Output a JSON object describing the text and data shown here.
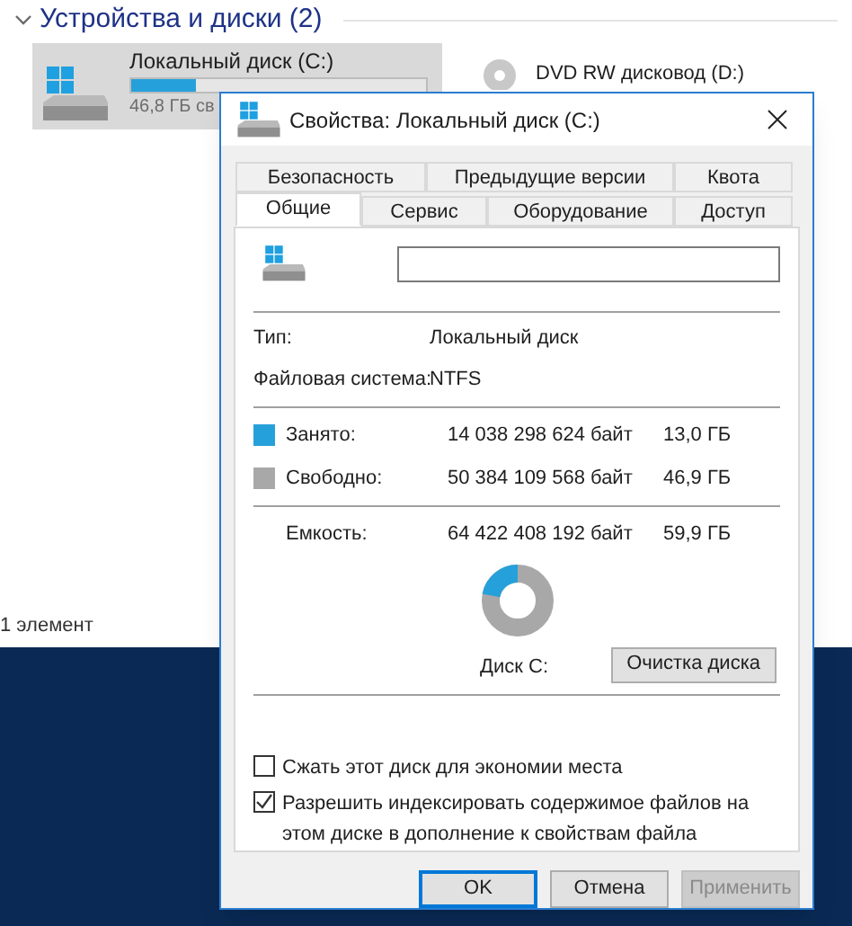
{
  "explorer": {
    "group_header": "Устройства и диски (2)",
    "drives": [
      {
        "kind": "hdd",
        "name": "Локальный диск (C:)",
        "selected": true,
        "level": 0.22,
        "free_text": "46,8 ГБ св"
      },
      {
        "kind": "dvd",
        "name": "DVD RW дисковод (D:)",
        "selected": false
      }
    ],
    "status_bar": "1 элемент"
  },
  "dialog": {
    "title": "Свойства: Локальный диск (C:)",
    "tab_rows": [
      [
        {
          "label": "Безопасность",
          "selected": false
        },
        {
          "label": "Предыдущие версии",
          "selected": false
        },
        {
          "label": "Квота",
          "selected": false
        }
      ],
      [
        {
          "label": "Общие",
          "selected": true
        },
        {
          "label": "Сервис",
          "selected": false
        },
        {
          "label": "Оборудование",
          "selected": false
        },
        {
          "label": "Доступ",
          "selected": false
        }
      ]
    ],
    "info": [
      {
        "label": "Тип:",
        "value": "Локальный диск"
      },
      {
        "label": "Файловая система:",
        "value": "NTFS"
      }
    ],
    "usage": [
      {
        "label": "Занято:",
        "bytes": "14 038 298 624 байт",
        "size": "13,0 ГБ",
        "color": "#26a0da"
      },
      {
        "label": "Свободно:",
        "bytes": "50 384 109 568 байт",
        "size": "46,9 ГБ",
        "color": "#a8a8a8"
      }
    ],
    "capacity": {
      "label": "Емкость:",
      "bytes": "64 422 408 192 байт",
      "size": "59,9 ГБ"
    },
    "donut": {
      "level": 0.22
    },
    "disk_label": "Диск C:",
    "cleanup_button": "Очистка диска",
    "options": [
      {
        "label": "Сжать этот диск для экономии места",
        "checked": false
      },
      {
        "label": "Разрешить индексировать содержимое файлов на этом диске в дополнение к свойствам файла",
        "checked": true
      }
    ],
    "buttons": [
      {
        "label": "OK",
        "default": true,
        "disabled": false
      },
      {
        "label": "Отмена",
        "default": false,
        "disabled": false
      },
      {
        "label": "Применить",
        "default": false,
        "disabled": true
      }
    ]
  }
}
